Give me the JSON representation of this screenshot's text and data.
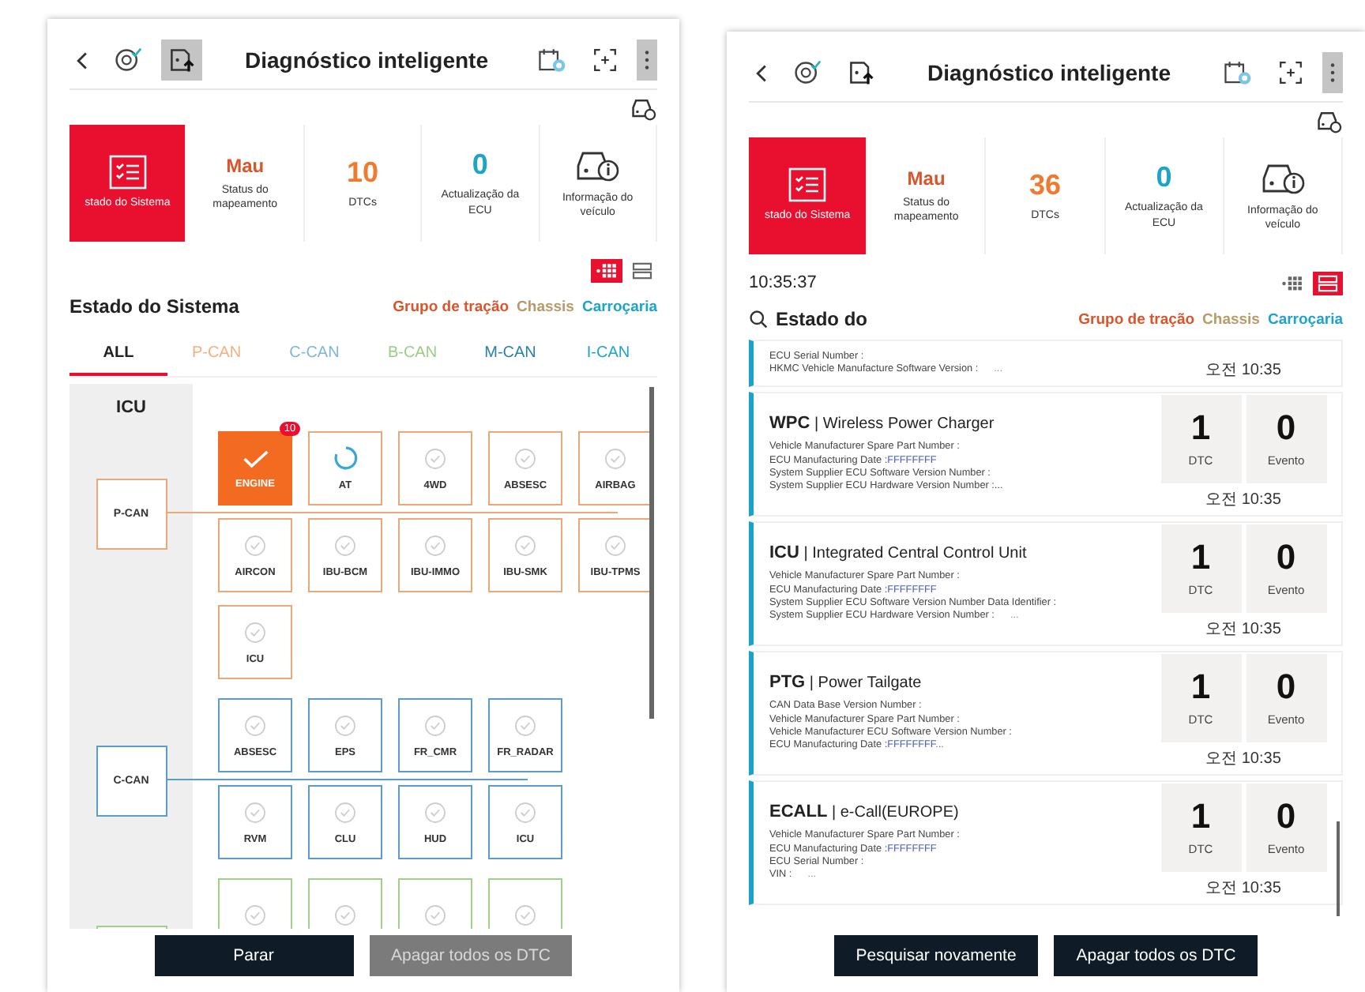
{
  "screens": [
    {
      "kind": "graph",
      "title": "Diagnóstico inteligente",
      "tools": [
        {
          "kind": "diagnosis",
          "selected": false
        },
        {
          "kind": "upload",
          "selected": true
        }
      ],
      "actions": [
        {
          "kind": "ecu",
          "selected": false
        },
        {
          "kind": "scan",
          "selected": false
        },
        {
          "kind": "menu",
          "selected": true
        }
      ],
      "summary": [
        {
          "kind": "system",
          "label": "stado do Sistema",
          "selected": true
        },
        {
          "kind": "mapping",
          "value": "Mau",
          "label": "Status do mapeamento",
          "selected": false
        },
        {
          "kind": "dtc",
          "value": "10",
          "label": "DTCs",
          "selected": false
        },
        {
          "kind": "ecu",
          "value": "0",
          "label": "Actualização da ECU",
          "selected": false
        },
        {
          "kind": "vehicle",
          "label": "Informação do veículo",
          "selected": false
        }
      ],
      "view_toggle": [
        {
          "kind": "graph",
          "selected": true
        },
        {
          "kind": "list",
          "selected": false
        }
      ],
      "section_title": "Estado do Sistema",
      "groups": [
        {
          "label": "Grupo de tração",
          "color": "#d9552b"
        },
        {
          "label": "Chassis",
          "color": "#b89a6a"
        },
        {
          "label": "Carroçaria",
          "color": "#1ea3c9"
        }
      ],
      "tabs": [
        {
          "label": "ALL",
          "selected": true,
          "color": "#222222"
        },
        {
          "label": "P-CAN",
          "selected": false,
          "color": "#f0b080"
        },
        {
          "label": "C-CAN",
          "selected": false,
          "color": "#7fb5d5"
        },
        {
          "label": "B-CAN",
          "selected": false,
          "color": "#9acd85"
        },
        {
          "label": "M-CAN",
          "selected": false,
          "color": "#2a7fa5"
        },
        {
          "label": "I-CAN",
          "selected": false,
          "color": "#1ea3c9"
        }
      ],
      "diagram": {
        "side_label": "ICU",
        "buses": [
          {
            "name": "P-CAN",
            "color": "#eaa878",
            "rows": [
              [
                {
                  "label": "ENGINE",
                  "kind": "done",
                  "dtc": "10"
                },
                {
                  "label": "AT",
                  "kind": "loading"
                },
                {
                  "label": "4WD",
                  "kind": "ok"
                },
                {
                  "label": "ABSESC",
                  "kind": "ok"
                },
                {
                  "label": "AIRBAG",
                  "kind": "ok"
                }
              ],
              [
                {
                  "label": "AIRCON",
                  "kind": "ok"
                },
                {
                  "label": "IBU-BCM",
                  "kind": "ok"
                },
                {
                  "label": "IBU-IMMO",
                  "kind": "ok"
                },
                {
                  "label": "IBU-SMK",
                  "kind": "ok"
                },
                {
                  "label": "IBU-TPMS",
                  "kind": "ok"
                }
              ],
              [
                {
                  "label": "ICU",
                  "kind": "ok"
                }
              ]
            ]
          },
          {
            "name": "C-CAN",
            "color": "#5c9cc8",
            "rows": [
              [
                {
                  "label": "ABSESC",
                  "kind": "ok"
                },
                {
                  "label": "EPS",
                  "kind": "ok"
                },
                {
                  "label": "FR_CMR",
                  "kind": "ok"
                },
                {
                  "label": "FR_RADAR",
                  "kind": "ok"
                }
              ],
              [
                {
                  "label": "RVM",
                  "kind": "ok"
                },
                {
                  "label": "CLU",
                  "kind": "ok"
                },
                {
                  "label": "HUD",
                  "kind": "ok"
                },
                {
                  "label": "ICU",
                  "kind": "ok"
                }
              ]
            ]
          },
          {
            "color": "#9fd08a",
            "rows": [
              [
                {
                  "kind": "ok"
                },
                {
                  "kind": "ok"
                },
                {
                  "kind": "ok"
                },
                {
                  "kind": "ok"
                }
              ]
            ]
          }
        ]
      },
      "buttons": [
        {
          "label": "Parar",
          "disabled": false
        },
        {
          "label": "Apagar todos os DTC",
          "disabled": true
        }
      ]
    },
    {
      "kind": "list",
      "title": "Diagnóstico inteligente",
      "tools": [
        {
          "kind": "diagnosis",
          "selected": false
        },
        {
          "kind": "upload",
          "selected": false
        }
      ],
      "actions": [
        {
          "kind": "ecu",
          "selected": false
        },
        {
          "kind": "scan",
          "selected": false
        },
        {
          "kind": "menu",
          "selected": true
        }
      ],
      "summary": [
        {
          "kind": "system",
          "label": "stado do Sistema",
          "selected": true
        },
        {
          "kind": "mapping",
          "value": "Mau",
          "label": "Status do mapeamento",
          "selected": false
        },
        {
          "kind": "dtc",
          "value": "36",
          "label": "DTCs",
          "selected": false
        },
        {
          "kind": "ecu",
          "value": "0",
          "label": "Actualização da ECU",
          "selected": false
        },
        {
          "kind": "vehicle",
          "label": "Informação do veículo",
          "selected": false
        }
      ],
      "view_toggle": [
        {
          "kind": "graph",
          "selected": false
        },
        {
          "kind": "list",
          "selected": true
        }
      ],
      "time": "10:35:37",
      "search": {
        "value": "Estado do"
      },
      "groups": [
        {
          "label": "Grupo de tração",
          "color": "#d9552b"
        },
        {
          "label": "Chassis",
          "color": "#b89a6a"
        },
        {
          "label": "Carroçaria",
          "color": "#1ea3c9"
        }
      ],
      "cards": [
        {
          "details": [
            {
              "label": "ECU Serial Number :"
            },
            {
              "label": "HKMC Vehicle Manufacture Software Version :",
              "trail": "..."
            }
          ],
          "time": "오전 10:35"
        },
        {
          "code": "WPC",
          "name": "| Wireless Power Charger",
          "details": [
            {
              "label": "Vehicle Manufacturer Spare Part Number :"
            },
            {
              "label": "ECU Manufacturing Date :",
              "value": "FFFFFFFF"
            },
            {
              "label": "System Supplier ECU Software Version Number :"
            },
            {
              "label": "System Supplier ECU Hardware Version Number :..."
            }
          ],
          "dtc": "1",
          "dtc_label": "DTC",
          "events": "0",
          "events_label": "Evento",
          "time": "오전 10:35"
        },
        {
          "code": "ICU",
          "name": "| Integrated Central Control Unit",
          "details": [
            {
              "label": "Vehicle Manufacturer Spare Part Number :"
            },
            {
              "label": "ECU Manufacturing Date :",
              "value": "FFFFFFFF"
            },
            {
              "label": "System Supplier ECU Software Version Number Data Identifier :"
            },
            {
              "label": "System Supplier ECU Hardware Version Number :",
              "trail": "..."
            }
          ],
          "dtc": "1",
          "dtc_label": "DTC",
          "events": "0",
          "events_label": "Evento",
          "time": "오전 10:35"
        },
        {
          "code": "PTG",
          "name": "| Power Tailgate",
          "details": [
            {
              "label": "CAN Data Base Version Number :"
            },
            {
              "label": "Vehicle Manufacturer Spare Part Number :"
            },
            {
              "label": "Vehicle Manufacturer ECU Software Version Number :"
            },
            {
              "label": "ECU Manufacturing Date :",
              "value": "FFFFFFFF..."
            }
          ],
          "dtc": "1",
          "dtc_label": "DTC",
          "events": "0",
          "events_label": "Evento",
          "time": "오전 10:35"
        },
        {
          "code": "ECALL",
          "name": "| e-Call(EUROPE)",
          "details": [
            {
              "label": "Vehicle Manufacturer Spare Part Number :"
            },
            {
              "label": "ECU Manufacturing Date :",
              "value": "FFFFFFFF"
            },
            {
              "label": "ECU Serial Number :"
            },
            {
              "label": "VIN :",
              "trail": "..."
            }
          ],
          "dtc": "1",
          "dtc_label": "DTC",
          "events": "0",
          "events_label": "Evento",
          "time": "오전 10:35"
        }
      ],
      "buttons": [
        {
          "label": "Pesquisar novamente",
          "disabled": false
        },
        {
          "label": "Apagar todos os DTC",
          "disabled": false
        }
      ]
    }
  ]
}
